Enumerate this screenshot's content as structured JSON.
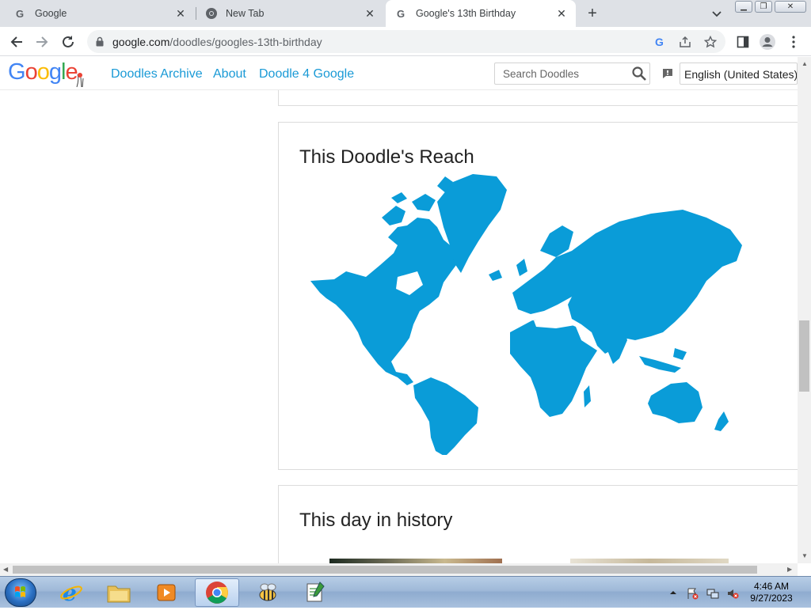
{
  "browser": {
    "tabs": [
      {
        "title": "Google",
        "active": false
      },
      {
        "title": "New Tab",
        "active": false
      },
      {
        "title": "Google's 13th Birthday",
        "active": true
      }
    ],
    "url_host": "google.com",
    "url_path": "/doodles/googles-13th-birthday"
  },
  "header": {
    "logo_text": "Google",
    "nav": {
      "archive": "Doodles Archive",
      "about": "About",
      "doodle4google": "Doodle 4 Google"
    },
    "search_placeholder": "Search Doodles",
    "language": "English (United States)"
  },
  "sections": {
    "reach_title": "This Doodle's Reach",
    "history_title": "This day in history"
  },
  "map": {
    "fill_color": "#0a9cd8"
  },
  "taskbar": {
    "apps": [
      "internet-explorer",
      "file-explorer",
      "media-player",
      "chrome",
      "bee-app",
      "notepad-app"
    ],
    "time": "4:46 AM",
    "date": "9/27/2023"
  }
}
